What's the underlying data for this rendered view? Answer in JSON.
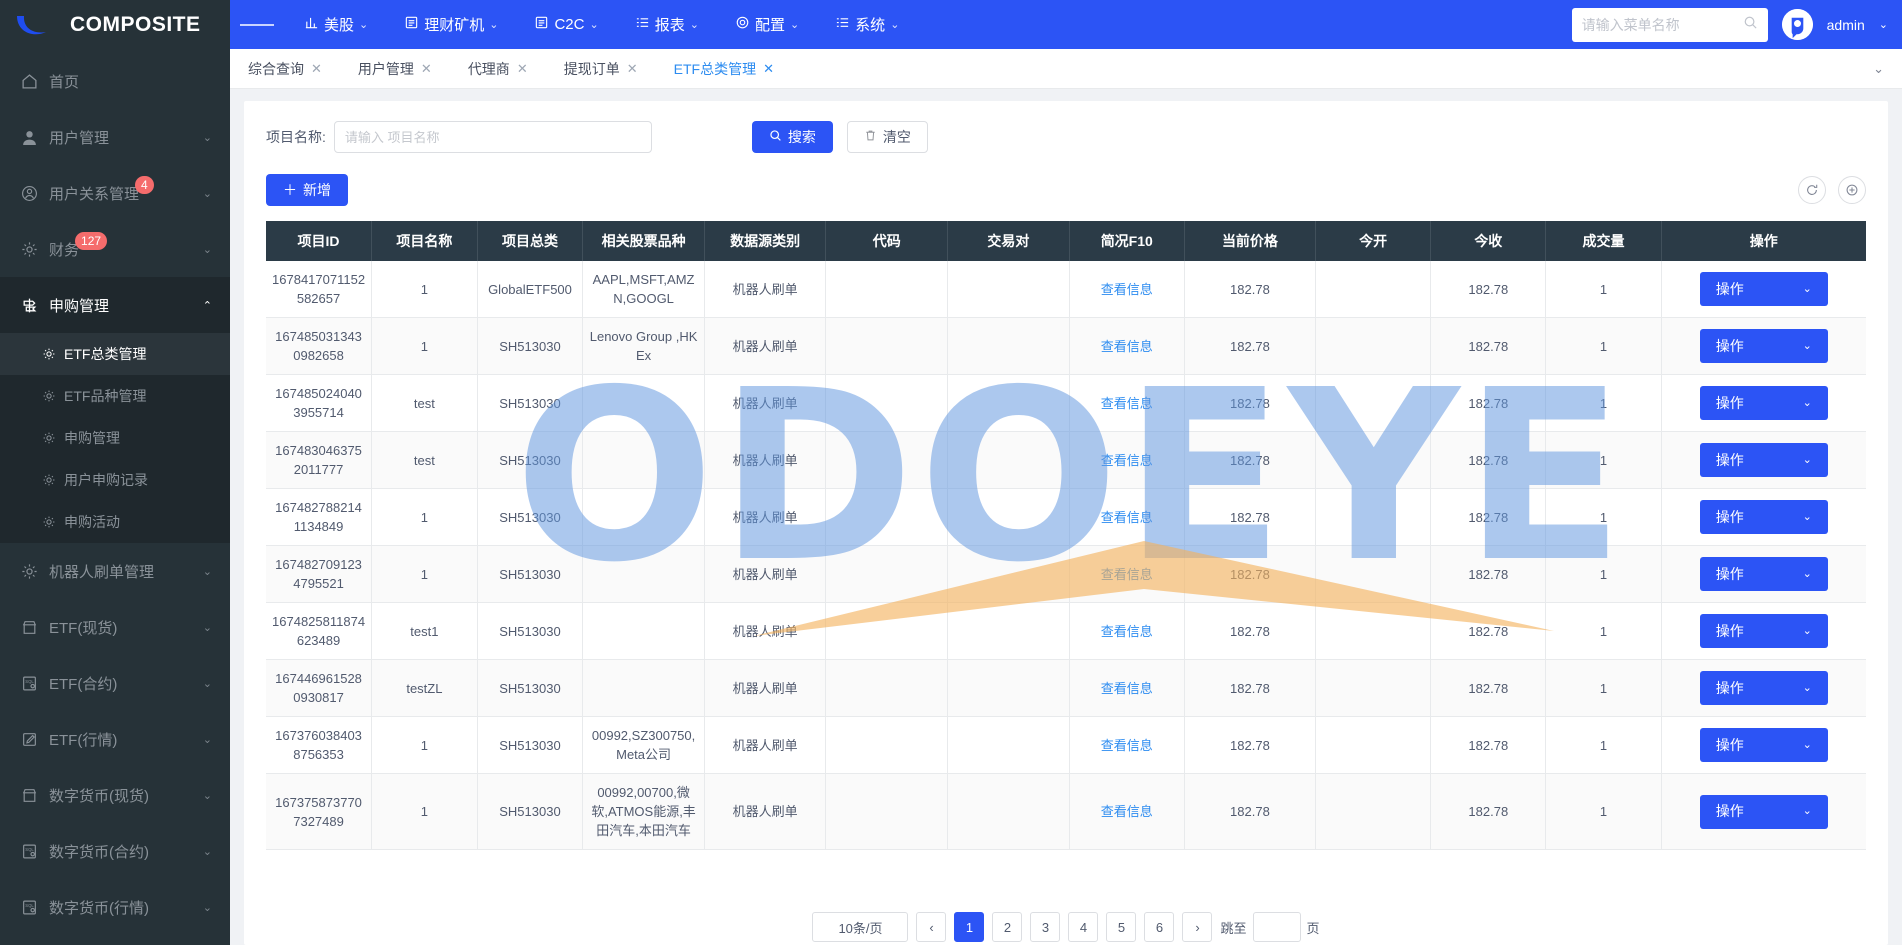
{
  "brand": {
    "title": "COMPOSITE"
  },
  "sidebar": {
    "items": [
      {
        "label": "首页",
        "icon": "home-icon",
        "caret": "",
        "badge": ""
      },
      {
        "label": "用户管理",
        "icon": "user-icon",
        "caret": "⌄",
        "badge": ""
      },
      {
        "label": "用户关系管理",
        "icon": "user-circle-icon",
        "caret": "⌄",
        "badge": "4"
      },
      {
        "label": "财务",
        "icon": "gear-icon",
        "caret": "⌄",
        "badge": "127"
      },
      {
        "label": "申购管理",
        "icon": "signpost-icon",
        "caret": "⌃",
        "badge": ""
      }
    ],
    "submenu": [
      {
        "label": "ETF总类管理",
        "active": true
      },
      {
        "label": "ETF品种管理",
        "active": false
      },
      {
        "label": "申购管理",
        "active": false
      },
      {
        "label": "用户申购记录",
        "active": false
      },
      {
        "label": "申购活动",
        "active": false
      }
    ],
    "items_after": [
      {
        "label": "机器人刷单管理",
        "icon": "gear-icon",
        "caret": "⌄"
      },
      {
        "label": "ETF(现货)",
        "icon": "shop-icon",
        "caret": "⌄"
      },
      {
        "label": "ETF(合约)",
        "icon": "sql-icon",
        "caret": "⌄"
      },
      {
        "label": "ETF(行情)",
        "icon": "edit-icon",
        "caret": "⌄"
      },
      {
        "label": "数字货币(现货)",
        "icon": "shop-icon",
        "caret": "⌄"
      },
      {
        "label": "数字货币(合约)",
        "icon": "sql-icon",
        "caret": "⌄"
      },
      {
        "label": "数字货币(行情)",
        "icon": "sql-icon",
        "caret": "⌄"
      }
    ]
  },
  "topbar": {
    "nav": [
      {
        "label": "美股",
        "icon": "chart-icon",
        "caret": "⌄"
      },
      {
        "label": "理财矿机",
        "icon": "doc-icon",
        "caret": "⌄"
      },
      {
        "label": "C2C",
        "icon": "doc-icon",
        "caret": "⌄"
      },
      {
        "label": "报表",
        "icon": "list-icon",
        "caret": "⌄"
      },
      {
        "label": "配置",
        "icon": "gear-icon",
        "caret": "⌄"
      },
      {
        "label": "系统",
        "icon": "list-icon",
        "caret": "⌄"
      }
    ],
    "search_placeholder": "请输入菜单名称",
    "search_value": "",
    "user": "admin",
    "user_caret": "⌄"
  },
  "tabs": [
    {
      "label": "综合查询",
      "active": false
    },
    {
      "label": "用户管理",
      "active": false
    },
    {
      "label": "代理商",
      "active": false
    },
    {
      "label": "提现订单",
      "active": false
    },
    {
      "label": "ETF总类管理",
      "active": true
    }
  ],
  "filter": {
    "label": "项目名称:",
    "placeholder": "请输入 项目名称",
    "value": "",
    "search_label": "搜索",
    "clear_label": "清空",
    "add_label": "新增"
  },
  "watermark": {
    "text": "ODOEYE"
  },
  "table": {
    "columns": [
      "项目ID",
      "项目名称",
      "项目总类",
      "相关股票品种",
      "数据源类别",
      "代码",
      "交易对",
      "简况F10",
      "当前价格",
      "今开",
      "今收",
      "成交量",
      "操作"
    ],
    "op_label": "操作",
    "f10_label": "查看信息",
    "rows": [
      {
        "id": "1678417071152582657",
        "name": "1",
        "category": "GlobalETF500",
        "stocks": "AAPL,MSFT,AMZN,GOOGL",
        "source": "机器人刷单",
        "code": "",
        "pair": "",
        "f10": "查看信息",
        "price": "182.78",
        "open": "",
        "close": "182.78",
        "volume": "1"
      },
      {
        "id": "1674850313430982658",
        "name": "1",
        "category": "SH513030",
        "stocks": "Lenovo Group ,HKEx",
        "source": "机器人刷单",
        "code": "",
        "pair": "",
        "f10": "查看信息",
        "price": "182.78",
        "open": "",
        "close": "182.78",
        "volume": "1"
      },
      {
        "id": "1674850240403955714",
        "name": "test",
        "category": "SH513030",
        "stocks": "",
        "source": "机器人刷单",
        "code": "",
        "pair": "",
        "f10": "查看信息",
        "price": "182.78",
        "open": "",
        "close": "182.78",
        "volume": "1"
      },
      {
        "id": "1674830463752011777",
        "name": "test",
        "category": "SH513030",
        "stocks": "",
        "source": "机器人刷单",
        "code": "",
        "pair": "",
        "f10": "查看信息",
        "price": "182.78",
        "open": "",
        "close": "182.78",
        "volume": "1"
      },
      {
        "id": "1674827882141134849",
        "name": "1",
        "category": "SH513030",
        "stocks": "",
        "source": "机器人刷单",
        "code": "",
        "pair": "",
        "f10": "查看信息",
        "price": "182.78",
        "open": "",
        "close": "182.78",
        "volume": "1"
      },
      {
        "id": "1674827091234795521",
        "name": "1",
        "category": "SH513030",
        "stocks": "",
        "source": "机器人刷单",
        "code": "",
        "pair": "",
        "f10": "查看信息",
        "price": "182.78",
        "open": "",
        "close": "182.78",
        "volume": "1"
      },
      {
        "id": "1674825811874623489",
        "name": "test1",
        "category": "SH513030",
        "stocks": "",
        "source": "机器人刷单",
        "code": "",
        "pair": "",
        "f10": "查看信息",
        "price": "182.78",
        "open": "",
        "close": "182.78",
        "volume": "1"
      },
      {
        "id": "1674469615280930817",
        "name": "testZL",
        "category": "SH513030",
        "stocks": "",
        "source": "机器人刷单",
        "code": "",
        "pair": "",
        "f10": "查看信息",
        "price": "182.78",
        "open": "",
        "close": "182.78",
        "volume": "1"
      },
      {
        "id": "1673760384038756353",
        "name": "1",
        "category": "SH513030",
        "stocks": "00992,SZ300750,Meta公司",
        "source": "机器人刷单",
        "code": "",
        "pair": "",
        "f10": "查看信息",
        "price": "182.78",
        "open": "",
        "close": "182.78",
        "volume": "1"
      },
      {
        "id": "1673758737707327489",
        "name": "1",
        "category": "SH513030",
        "stocks": "00992,00700,微软,ATMOS能源,丰田汽车,本田汽车",
        "source": "机器人刷单",
        "code": "",
        "pair": "",
        "f10": "查看信息",
        "price": "182.78",
        "open": "",
        "close": "182.78",
        "volume": "1"
      }
    ]
  },
  "pagination": {
    "page_size": "10条/页",
    "prev": "‹",
    "pages": [
      "1",
      "2",
      "3",
      "4",
      "5",
      "6"
    ],
    "current": "1",
    "next": "›",
    "jump_label": "跳至",
    "jump_value": "",
    "jump_unit": "页"
  },
  "colors": {
    "primary": "#2c54f5",
    "sidebar_bg": "#263238",
    "table_header_bg": "#2b3b47",
    "link": "#2d8cf0",
    "badge": "#f56c6c",
    "watermark": "#6096de"
  }
}
